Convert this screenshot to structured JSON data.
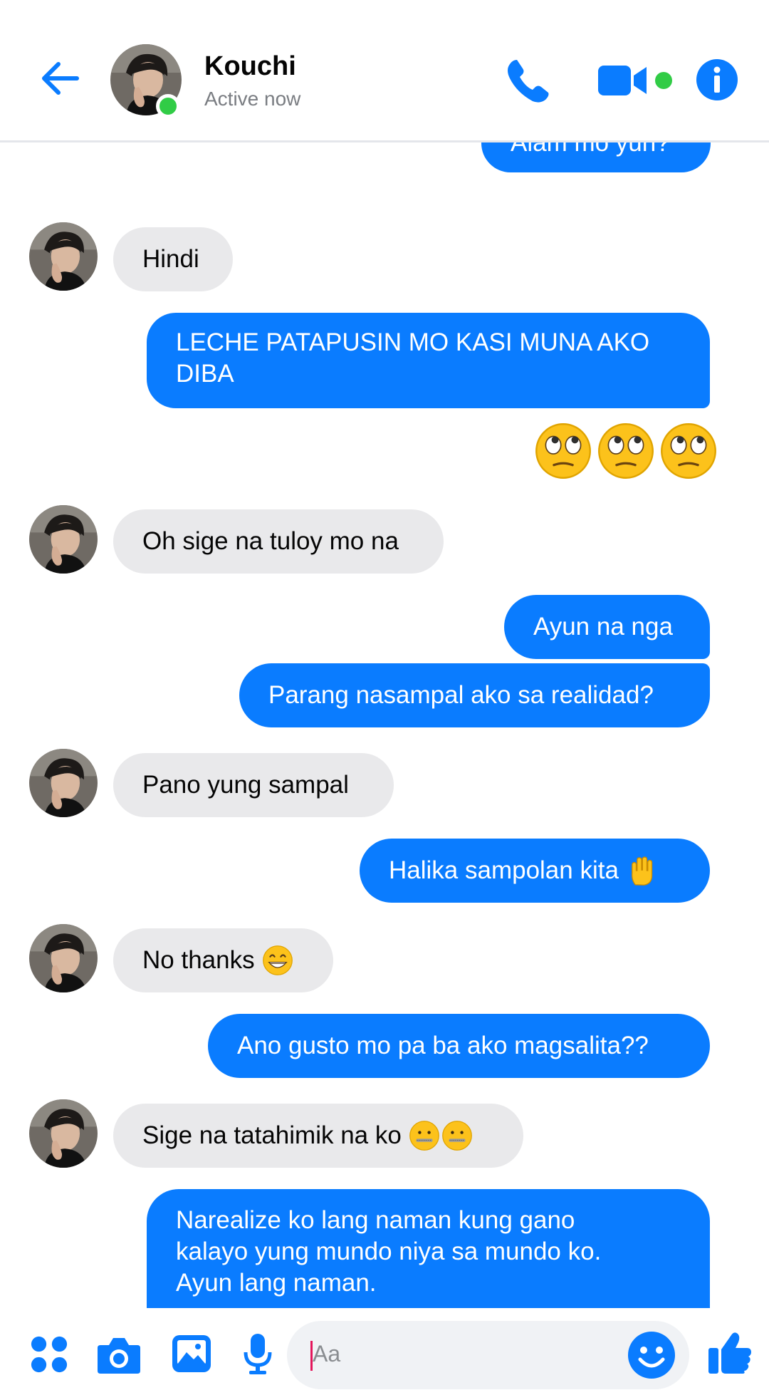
{
  "header": {
    "contact_name": "Kouchi",
    "status": "Active now"
  },
  "messages": [
    {
      "from": "me",
      "text": "Alam mo yun?"
    },
    {
      "from": "them",
      "text": "Hindi"
    },
    {
      "from": "me",
      "text": "LECHE PATAPUSIN MO KASI MUNA AKO DIBA"
    },
    {
      "from": "me",
      "emoji": [
        "face-with-rolling-eyes",
        "face-with-rolling-eyes",
        "face-with-rolling-eyes"
      ]
    },
    {
      "from": "them",
      "text": "Oh sige na tuloy mo na"
    },
    {
      "from": "me",
      "text": "Ayun na nga"
    },
    {
      "from": "me",
      "text": "Parang nasampal ako sa realidad?"
    },
    {
      "from": "them",
      "text": "Pano yung sampal"
    },
    {
      "from": "me",
      "text": "Halika sampolan kita",
      "emoji": [
        "raised-hand"
      ]
    },
    {
      "from": "them",
      "text": "No thanks",
      "emoji": [
        "grinning-face"
      ]
    },
    {
      "from": "me",
      "text": "Ano gusto mo pa ba ako magsalita??"
    },
    {
      "from": "them",
      "text": "Sige na tatahimik na ko",
      "emoji": [
        "zipper-mouth-face",
        "zipper-mouth-face"
      ]
    },
    {
      "from": "me",
      "text": "Narealize ko lang naman kung gano kalayo yung mundo niya sa mundo ko. Ayun lang naman."
    }
  ],
  "composer": {
    "placeholder": "Aa",
    "icons": [
      "apps-icon",
      "camera-icon",
      "gallery-icon",
      "microphone-icon",
      "emoji-icon",
      "like-icon"
    ]
  },
  "colors": {
    "accent": "#0a7cff",
    "incoming_bubble": "#e9e9eb",
    "online": "#31cc46"
  }
}
